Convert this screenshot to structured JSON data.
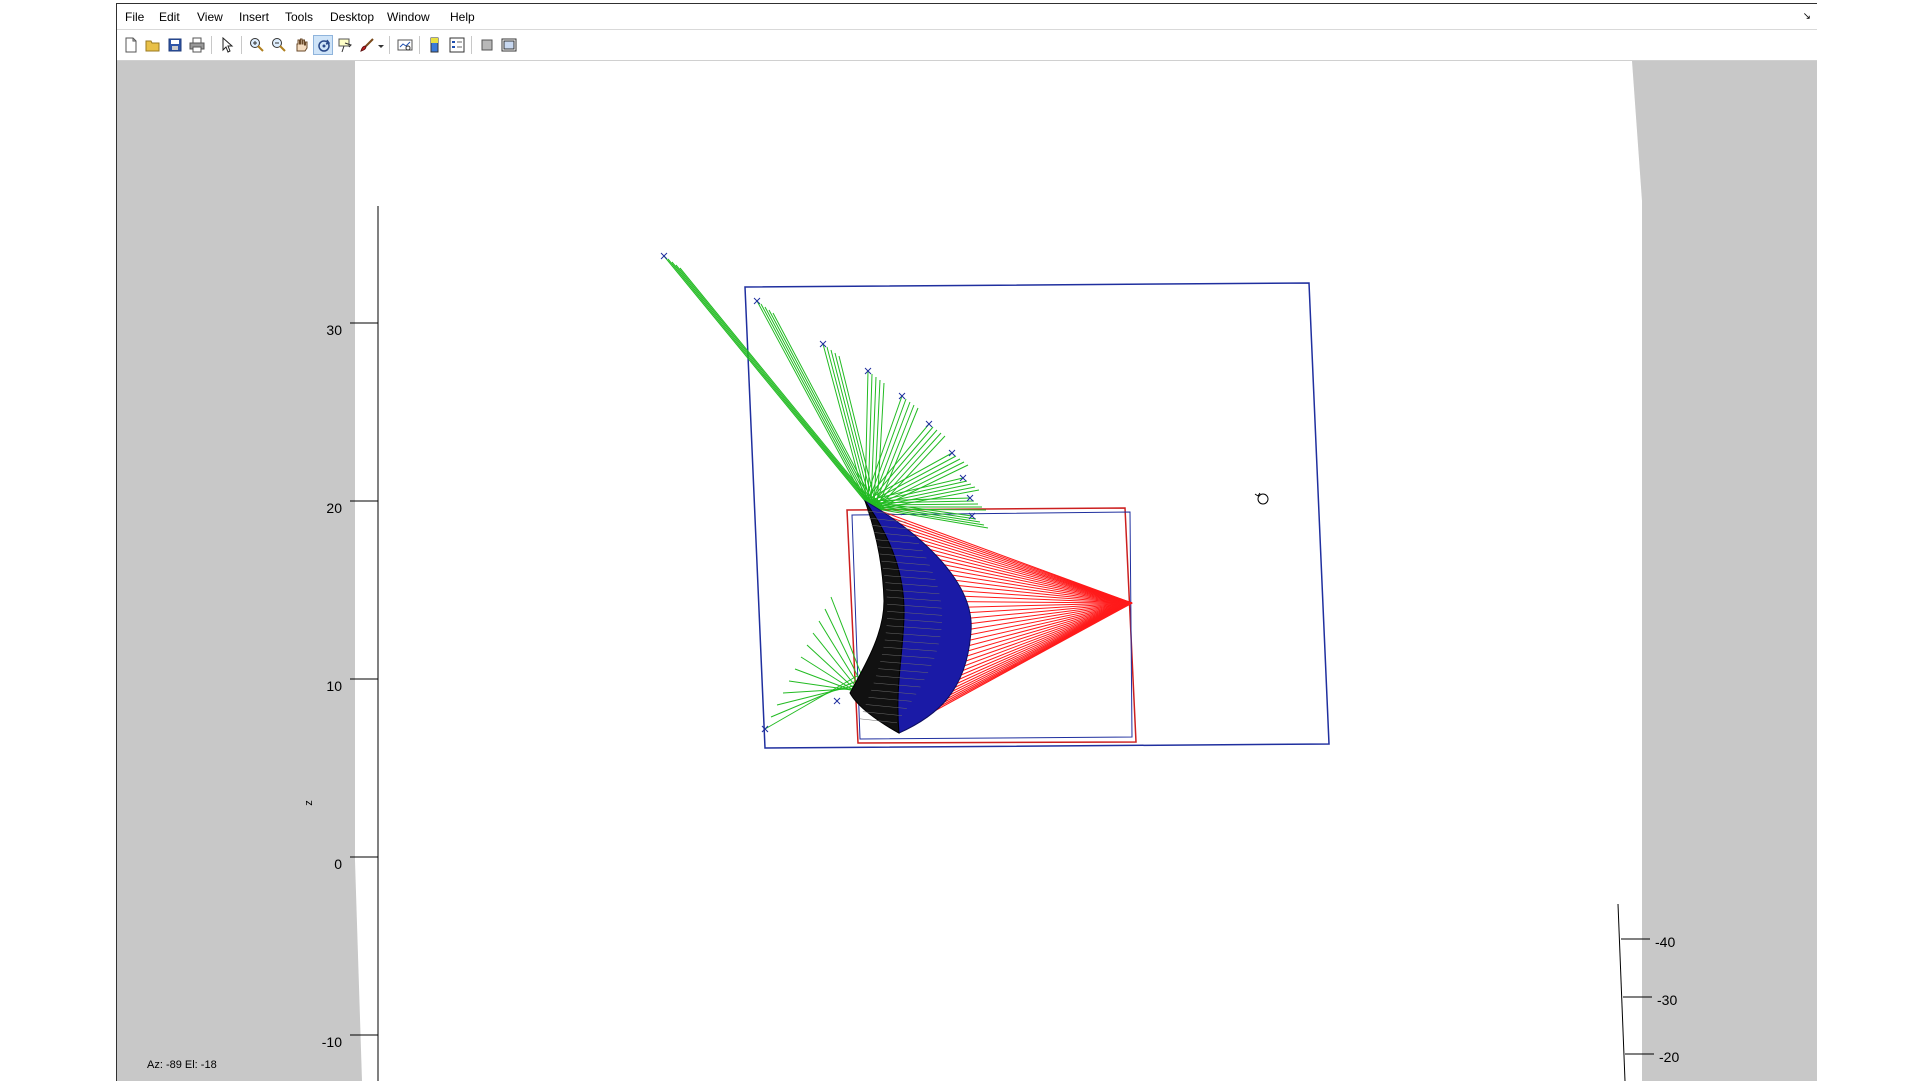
{
  "menu": [
    "File",
    "Edit",
    "View",
    "Insert",
    "Tools",
    "Desktop",
    "Window",
    "Help"
  ],
  "toolbar": {
    "icons": [
      "new-figure-icon",
      "open-file-icon",
      "save-figure-icon",
      "print-figure-icon",
      "edit-plot-icon",
      "zoom-in-icon",
      "zoom-out-icon",
      "pan-icon",
      "rotate-3d-icon",
      "data-cursor-icon",
      "brush-icon",
      "link-plot-icon",
      "colorbar-icon",
      "legend-icon",
      "hide-plot-tools-icon",
      "show-plot-tools-icon"
    ],
    "active": "rotate-3d-icon"
  },
  "axes": {
    "z_ticks": [
      "30",
      "20",
      "10",
      "0",
      "-10"
    ],
    "z_label": "z",
    "y_ticks": [
      "-40",
      "-30",
      "-20"
    ]
  },
  "status": "Az: -89 El: -18",
  "colors": {
    "accent_active": "#cfe4f8",
    "panel_gray": "#c8c8c8",
    "frame_blue": "#1f2f9f",
    "frame_red": "#cc1f1f",
    "rays_green": "#22bb22",
    "rays_red": "#ff1a1a",
    "surface_blue": "#1a1aa6",
    "surface_black": "#111111"
  }
}
